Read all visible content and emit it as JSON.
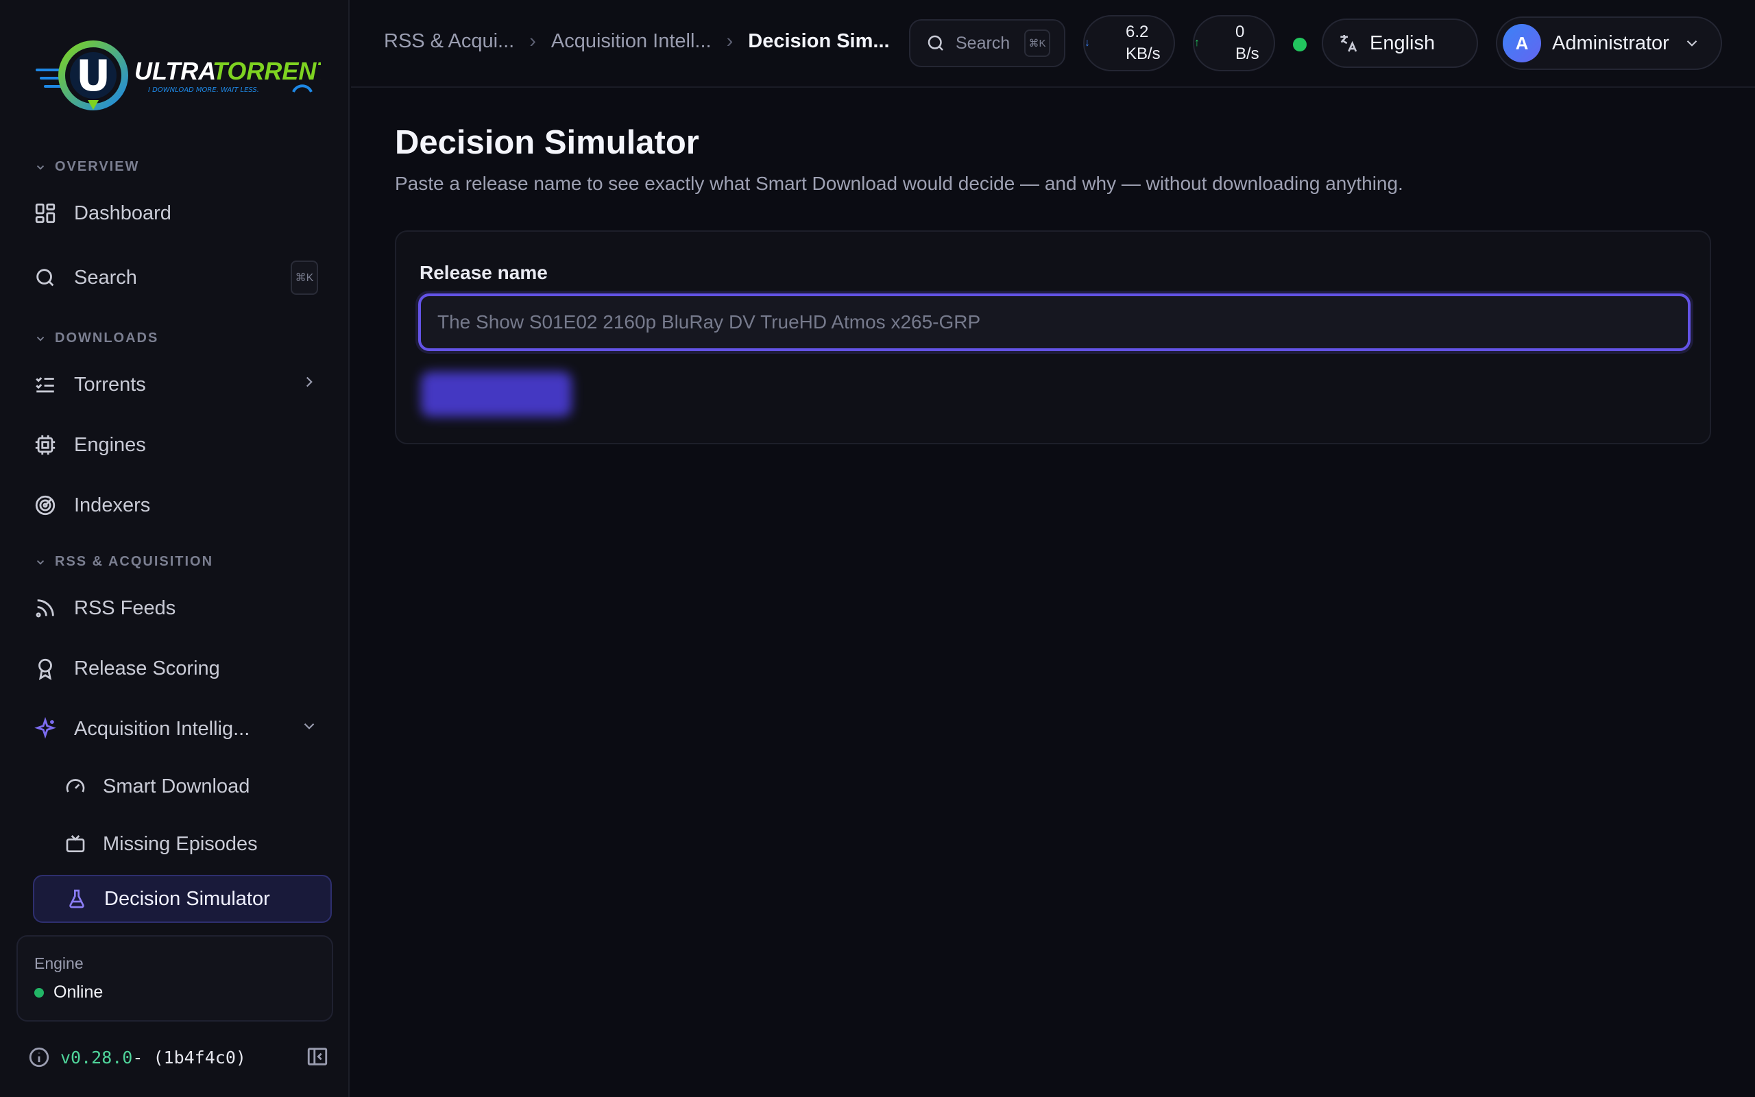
{
  "brand": {
    "name": "ULTRATORRENT",
    "tagline": "I DOWNLOAD MORE. WAIT LESS.",
    "logo_letter": "U",
    "colors": {
      "green": "#7ed321",
      "blue": "#1e88e5"
    }
  },
  "sidebar": {
    "sections": {
      "overview": "OVERVIEW",
      "downloads": "DOWNLOADS",
      "rss": "RSS & ACQUISITION"
    },
    "items": {
      "dashboard": "Dashboard",
      "search": "Search",
      "search_kbd": "⌘K",
      "torrents": "Torrents",
      "engines": "Engines",
      "indexers": "Indexers",
      "rss_feeds": "RSS Feeds",
      "release_scoring": "Release Scoring",
      "acquisition": "Acquisition Intellig...",
      "smart_download": "Smart Download",
      "missing_episodes": "Missing Episodes",
      "decision_simulator": "Decision Simulator"
    },
    "engine": {
      "label": "Engine",
      "status": "Online"
    },
    "version": {
      "number": "v0.28.0",
      "hash": " - (1b4f4c0)"
    }
  },
  "header": {
    "breadcrumbs": [
      "RSS & Acqui...",
      "Acquisition Intell...",
      "Decision Sim..."
    ],
    "search": {
      "label": "Search",
      "kbd": "⌘K"
    },
    "download_rate": {
      "value": "6.2",
      "unit": "KB/s"
    },
    "upload_rate": {
      "value": "0",
      "unit": "B/s"
    },
    "language": "English",
    "user": {
      "initial": "A",
      "name": "Administrator"
    }
  },
  "main": {
    "title": "Decision Simulator",
    "subtitle": "Paste a release name to see exactly what Smart Download would decide — and why — without downloading anything.",
    "form": {
      "label": "Release name",
      "placeholder": "The Show S01E02 2160p BluRay DV TrueHD Atmos x265-GRP",
      "value": ""
    },
    "accent_color": "#6353e6"
  }
}
